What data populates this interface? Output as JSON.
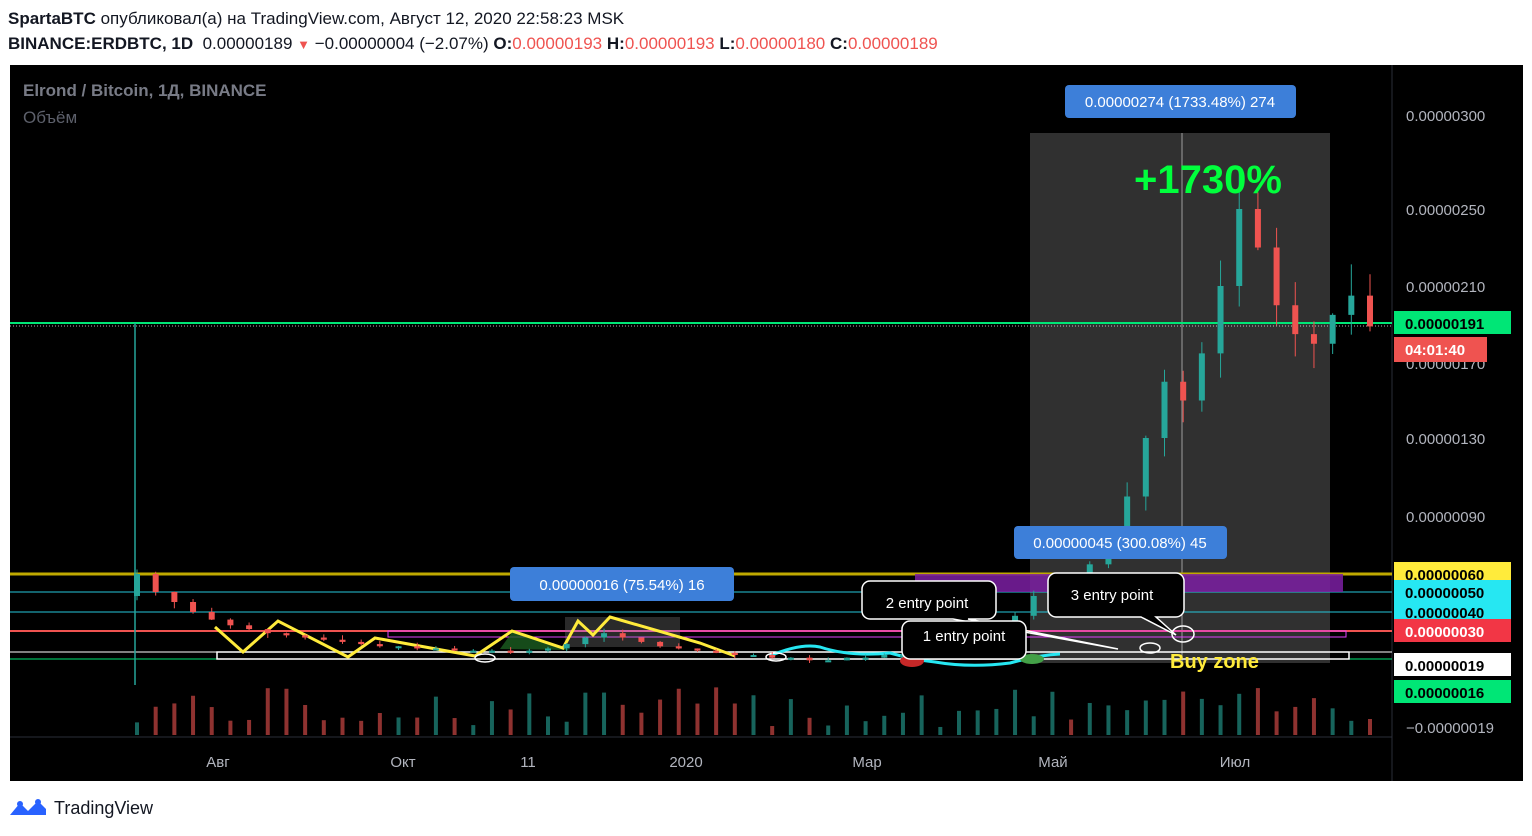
{
  "header": {
    "author": "SpartaBTC",
    "published_text": "опубликовал(а) на TradingView.com, Август 12, 2020 22:58:23 MSK",
    "symbol": "BINANCE:ERDBTC, 1D",
    "last": "0.00000189",
    "change": "−0.00000004 (−2.07%)",
    "o_label": "O:",
    "o": "0.00000193",
    "h_label": "H:",
    "h": "0.00000193",
    "l_label": "L:",
    "l": "0.00000180",
    "c_label": "C:",
    "c": "0.00000189"
  },
  "legend": {
    "title": "Elrond / Bitcoin, 1Д, BINANCE",
    "volume": "Объём"
  },
  "annotations": {
    "big_gain": "+1730%",
    "measure_top": "0.00000274 (1733.48%) 274",
    "measure_mid": "0.00000045 (300.08%) 45",
    "measure_left": "0.00000016 (75.54%) 16",
    "entry1": "1 entry point",
    "entry2": "2 entry point",
    "entry3": "3 entry point",
    "buy_zone": "Buy zone",
    "countdown": "04:01:40"
  },
  "footer": {
    "brand": "TradingView"
  },
  "colors": {
    "background": "#000000",
    "green": "#00e676",
    "yellow": "#ffeb3b",
    "cyan": "#26e7f2",
    "red": "#ef5350",
    "magenta": "#e040fb",
    "purple": "#7b1fa2",
    "blue_label": "#3d7fd9",
    "up_candle": "#26a69a",
    "down_candle": "#ef5350",
    "gain_text": "#00ff3c"
  },
  "chart_data": {
    "type": "candlestick",
    "y_axis_ticks": [
      "0.00000300",
      "0.00000250",
      "0.00000210",
      "0.00000170",
      "0.00000130",
      "0.00000090",
      "0.00000060",
      "0.00000050",
      "0.00000040",
      "0.00000030",
      "0.00000019",
      "0.00000016",
      "−0.00000019"
    ],
    "y_axis_highlighted": [
      {
        "label": "0.00000191",
        "bg": "#00e676",
        "fg": "#000000"
      },
      {
        "label": "0.00000060",
        "bg": "#ffeb3b",
        "fg": "#000000"
      },
      {
        "label": "0.00000050",
        "bg": "#26e7f2",
        "fg": "#000000"
      },
      {
        "label": "0.00000040",
        "bg": "#26e7f2",
        "fg": "#000000"
      },
      {
        "label": "0.00000030",
        "bg": "#f23645",
        "fg": "#ffffff"
      },
      {
        "label": "0.00000019",
        "bg": "#ffffff",
        "fg": "#000000"
      },
      {
        "label": "0.00000016",
        "bg": "#00e676",
        "fg": "#000000"
      }
    ],
    "x_axis_ticks": [
      "Авг",
      "Окт",
      "11",
      "2020",
      "Мар",
      "Май",
      "Июл"
    ],
    "closes": [
      6e-07,
      5e-07,
      4.5e-07,
      4e-07,
      3.6e-07,
      3.3e-07,
      3.1e-07,
      2.9e-07,
      2.8e-07,
      2.7e-07,
      2.6e-07,
      2.5e-07,
      2.4e-07,
      2.3e-07,
      2.3e-07,
      2.2e-07,
      2.2e-07,
      2.1e-07,
      2.1e-07,
      2.1e-07,
      2e-07,
      2.1e-07,
      2.2e-07,
      2.4e-07,
      2.7e-07,
      2.9e-07,
      2.7e-07,
      2.5e-07,
      2.3e-07,
      2.2e-07,
      2.1e-07,
      2e-07,
      1.9e-07,
      1.9e-07,
      1.8e-07,
      1.8e-07,
      1.7e-07,
      1.7e-07,
      1.8e-07,
      1.8e-07,
      1.9e-07,
      1.9e-07,
      2e-07,
      2.1e-07,
      2.3e-07,
      2.6e-07,
      3.1e-07,
      3.8e-07,
      4.8e-07,
      5.8e-07,
      5.5e-07,
      6.5e-07,
      8e-07,
      1e-06,
      1.3e-06,
      1.6e-06,
      1.5e-06,
      1.75e-06,
      2.1e-06,
      2.5e-06,
      2.3e-06,
      2e-06,
      1.85e-06,
      1.8e-06,
      1.95e-06,
      2.05e-06,
      1.89e-06
    ],
    "volume_visible": true,
    "grid": false
  }
}
